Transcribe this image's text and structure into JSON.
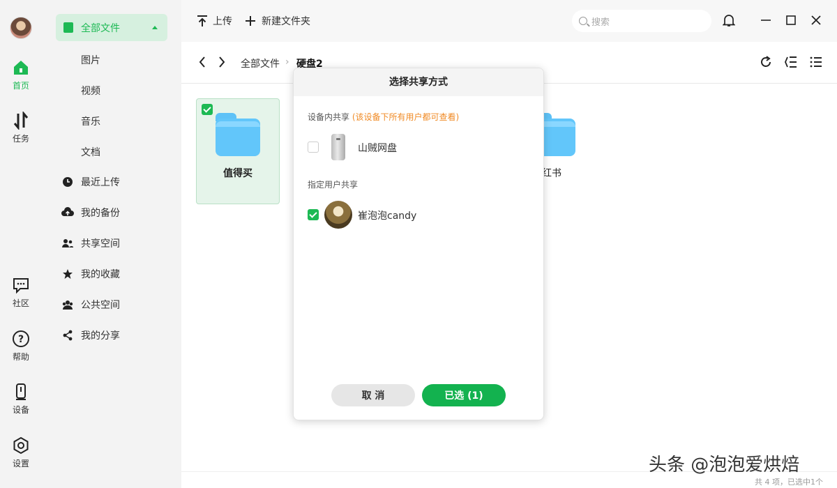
{
  "colors": {
    "accent": "#1db954",
    "note": "#f08a24",
    "folder": "#62c6fa"
  },
  "rail": {
    "items": [
      {
        "label": "首页",
        "icon": "home-icon"
      },
      {
        "label": "任务",
        "icon": "transfer-icon"
      },
      {
        "label": "社区",
        "icon": "community-icon"
      },
      {
        "label": "帮助",
        "icon": "help-icon"
      },
      {
        "label": "设备",
        "icon": "device-icon"
      },
      {
        "label": "设置",
        "icon": "settings-icon"
      }
    ]
  },
  "sidebar": {
    "head": "全部文件",
    "sub_items": [
      "图片",
      "视频",
      "音乐",
      "文档"
    ],
    "items": [
      {
        "label": "最近上传",
        "icon": "clock-icon"
      },
      {
        "label": "我的备份",
        "icon": "cloud-upload-icon"
      },
      {
        "label": "共享空间",
        "icon": "users-icon"
      },
      {
        "label": "我的收藏",
        "icon": "star-icon"
      },
      {
        "label": "公共空间",
        "icon": "group-icon"
      },
      {
        "label": "我的分享",
        "icon": "share-icon"
      }
    ]
  },
  "toolbar": {
    "upload": "上传",
    "new_folder": "新建文件夹",
    "search_placeholder": "搜索"
  },
  "breadcrumb": {
    "root": "全部文件",
    "current": "硬盘2"
  },
  "folders": [
    {
      "name": "值得买",
      "selected": true
    },
    {
      "name": "小红书",
      "selected": false
    }
  ],
  "modal": {
    "title": "选择共享方式",
    "device_section": "设备内共享",
    "device_note": "(该设备下所有用户都可查看)",
    "device_name": "山贼网盘",
    "user_section": "指定用户共享",
    "user_name": "崔泡泡candy",
    "cancel": "取 消",
    "confirm": "已选 (1)"
  },
  "status": "共 4 项，已选中1个",
  "watermark": "头条 @泡泡爱烘焙"
}
